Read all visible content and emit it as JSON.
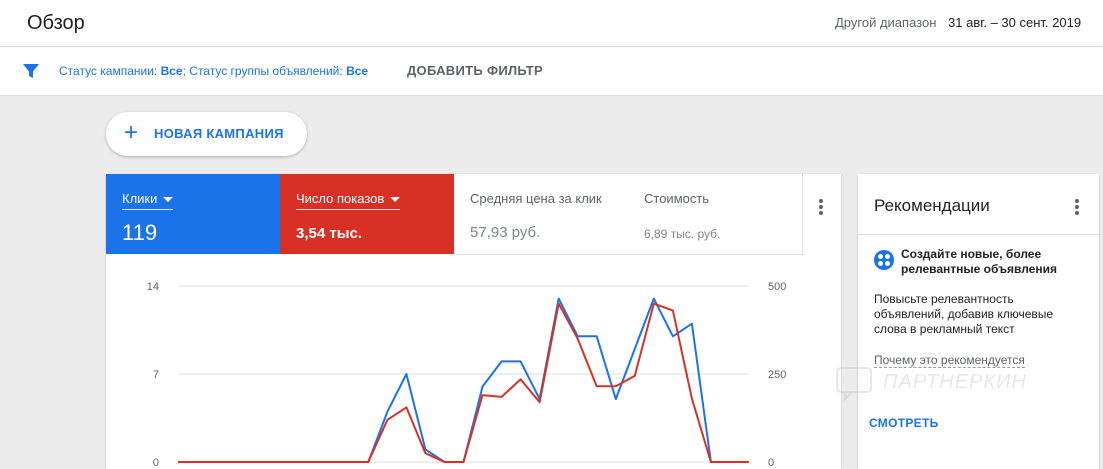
{
  "header": {
    "title": "Обзор",
    "range_label": "Другой диапазон",
    "range_value": "31 авг. – 30 сент. 2019"
  },
  "filters": {
    "status_campaign_label": "Статус кампании:",
    "status_campaign_value": "Все",
    "status_adgroup_label": "; Статус группы объявлений:",
    "status_adgroup_value": "Все",
    "add_filter": "ДОБАВИТЬ ФИЛЬТР"
  },
  "new_campaign": {
    "label": "НОВАЯ КАМПАНИЯ"
  },
  "metrics": [
    {
      "name": "Клики",
      "value": "119",
      "color": "#1a73e8"
    },
    {
      "name": "Число показов",
      "value": "3,54 тыс.",
      "color": "#d93025"
    },
    {
      "name": "Средняя цена за клик",
      "value": "57,93 руб."
    },
    {
      "name": "Стоимость",
      "value": "6,89 тыс. руб."
    }
  ],
  "chart_data": {
    "type": "line",
    "left_axis": {
      "ticks": [
        "14",
        "7",
        "0"
      ],
      "ylim": [
        0,
        14
      ]
    },
    "right_axis": {
      "ticks": [
        "500",
        "250",
        "0"
      ],
      "ylim": [
        0,
        500
      ]
    },
    "grid": true,
    "series": [
      {
        "name": "Клики",
        "axis": "left",
        "color": "#1a73e8",
        "values": [
          0,
          0,
          0,
          0,
          0,
          0,
          0,
          0,
          0,
          0,
          0,
          4,
          7,
          1,
          0,
          0,
          6,
          8,
          8,
          5,
          13,
          10,
          10,
          5,
          9,
          13,
          10,
          11,
          0,
          0,
          0
        ]
      },
      {
        "name": "Число показов",
        "axis": "right",
        "color": "#d93025",
        "values": [
          0,
          0,
          0,
          0,
          0,
          0,
          0,
          0,
          0,
          0,
          0,
          120,
          155,
          25,
          0,
          0,
          190,
          185,
          235,
          170,
          450,
          350,
          215,
          215,
          245,
          450,
          430,
          180,
          0,
          0,
          0
        ]
      }
    ]
  },
  "recommendations": {
    "title": "Рекомендации",
    "headline": "Создайте новые, более релевантные объявления",
    "body": "Повысьте релевантность объявлений, добавив ключевые слова в рекламный текст",
    "why": "Почему это рекомендуется",
    "action": "СМОТРЕТЬ"
  },
  "watermark": {
    "text": "ПАРТНЕРКИН"
  }
}
